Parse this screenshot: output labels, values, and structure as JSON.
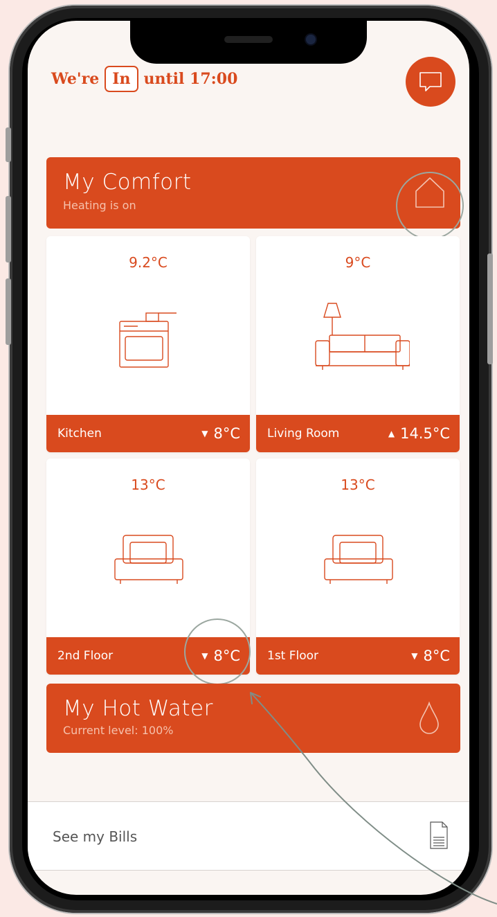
{
  "status": {
    "prefix": "We're",
    "state": "In",
    "suffix": "until 17:00"
  },
  "comfort": {
    "title": "My Comfort",
    "subtitle": "Heating is on"
  },
  "rooms": [
    {
      "name": "Kitchen",
      "current_temp": "9.2°C",
      "setpoint": "8°C",
      "direction": "down",
      "icon": "oven-icon"
    },
    {
      "name": "Living Room",
      "current_temp": "9°C",
      "setpoint": "14.5°C",
      "direction": "up",
      "icon": "sofa-icon"
    },
    {
      "name": "2nd Floor",
      "current_temp": "13°C",
      "setpoint": "8°C",
      "direction": "down",
      "icon": "bed-icon"
    },
    {
      "name": "1st Floor",
      "current_temp": "13°C",
      "setpoint": "8°C",
      "direction": "down",
      "icon": "bed-icon"
    }
  ],
  "arrows": {
    "up": "▲",
    "down": "▼"
  },
  "hot_water": {
    "title": "My Hot Water",
    "subtitle": "Current level: 100%"
  },
  "bills": {
    "label": "See my Bills"
  },
  "colors": {
    "accent": "#d94a1e",
    "background": "#faf5f2",
    "page_background": "#fbe9e5"
  }
}
